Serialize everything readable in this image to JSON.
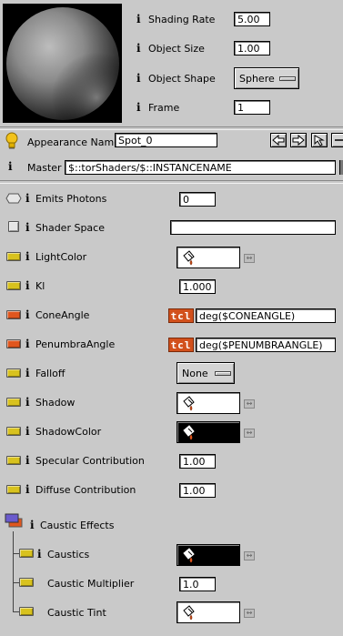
{
  "preview": {
    "shading_rate_label": "Shading Rate",
    "shading_rate_value": "5.00",
    "object_size_label": "Object Size",
    "object_size_value": "1.00",
    "object_shape_label": "Object Shape",
    "object_shape_value": "Sphere",
    "frame_label": "Frame",
    "frame_value": "1"
  },
  "header": {
    "appearance_label": "Appearance Name",
    "appearance_value": "Spot_0",
    "master_label": "Master",
    "master_value": "$::torShaders/$::INSTANCENAME"
  },
  "params": {
    "emits_photons": {
      "label": "Emits Photons",
      "value": "0"
    },
    "shader_space": {
      "label": "Shader Space",
      "value": ""
    },
    "light_color": {
      "label": "LightColor",
      "color": "#ffffff"
    },
    "kl": {
      "label": "Kl",
      "value": "1.000"
    },
    "cone_angle": {
      "label": "ConeAngle",
      "tcl": "tcl",
      "value": "deg($CONEANGLE)"
    },
    "penumbra_angle": {
      "label": "PenumbraAngle",
      "tcl": "tcl",
      "value": "deg($PENUMBRAANGLE)"
    },
    "falloff": {
      "label": "Falloff",
      "value": "None"
    },
    "shadow": {
      "label": "Shadow",
      "color": "#ffffff"
    },
    "shadow_color": {
      "label": "ShadowColor",
      "color": "#000000"
    },
    "specular": {
      "label": "Specular Contribution",
      "value": "1.00"
    },
    "diffuse": {
      "label": "Diffuse Contribution",
      "value": "1.00"
    },
    "caustic_effects": {
      "label": "Caustic Effects"
    },
    "caustics": {
      "label": "Caustics",
      "color": "#000000"
    },
    "caustic_multiplier": {
      "label": "Caustic Multiplier",
      "value": "1.0"
    },
    "caustic_tint": {
      "label": "Caustic Tint",
      "color": "#ffffff"
    }
  },
  "colors": {
    "panel_bg": "#c9c9c9",
    "swatch_yellow": "#d8c21e",
    "swatch_orange": "#e0561e",
    "tcl_orange": "#d2501c",
    "swatch_purple": "#6a5acd"
  },
  "icons": [
    "bulb-icon",
    "info-icon",
    "paint-bucket-icon",
    "back-arrow-icon",
    "forward-arrow-icon",
    "cursor-icon",
    "double-arrow-icon"
  ]
}
